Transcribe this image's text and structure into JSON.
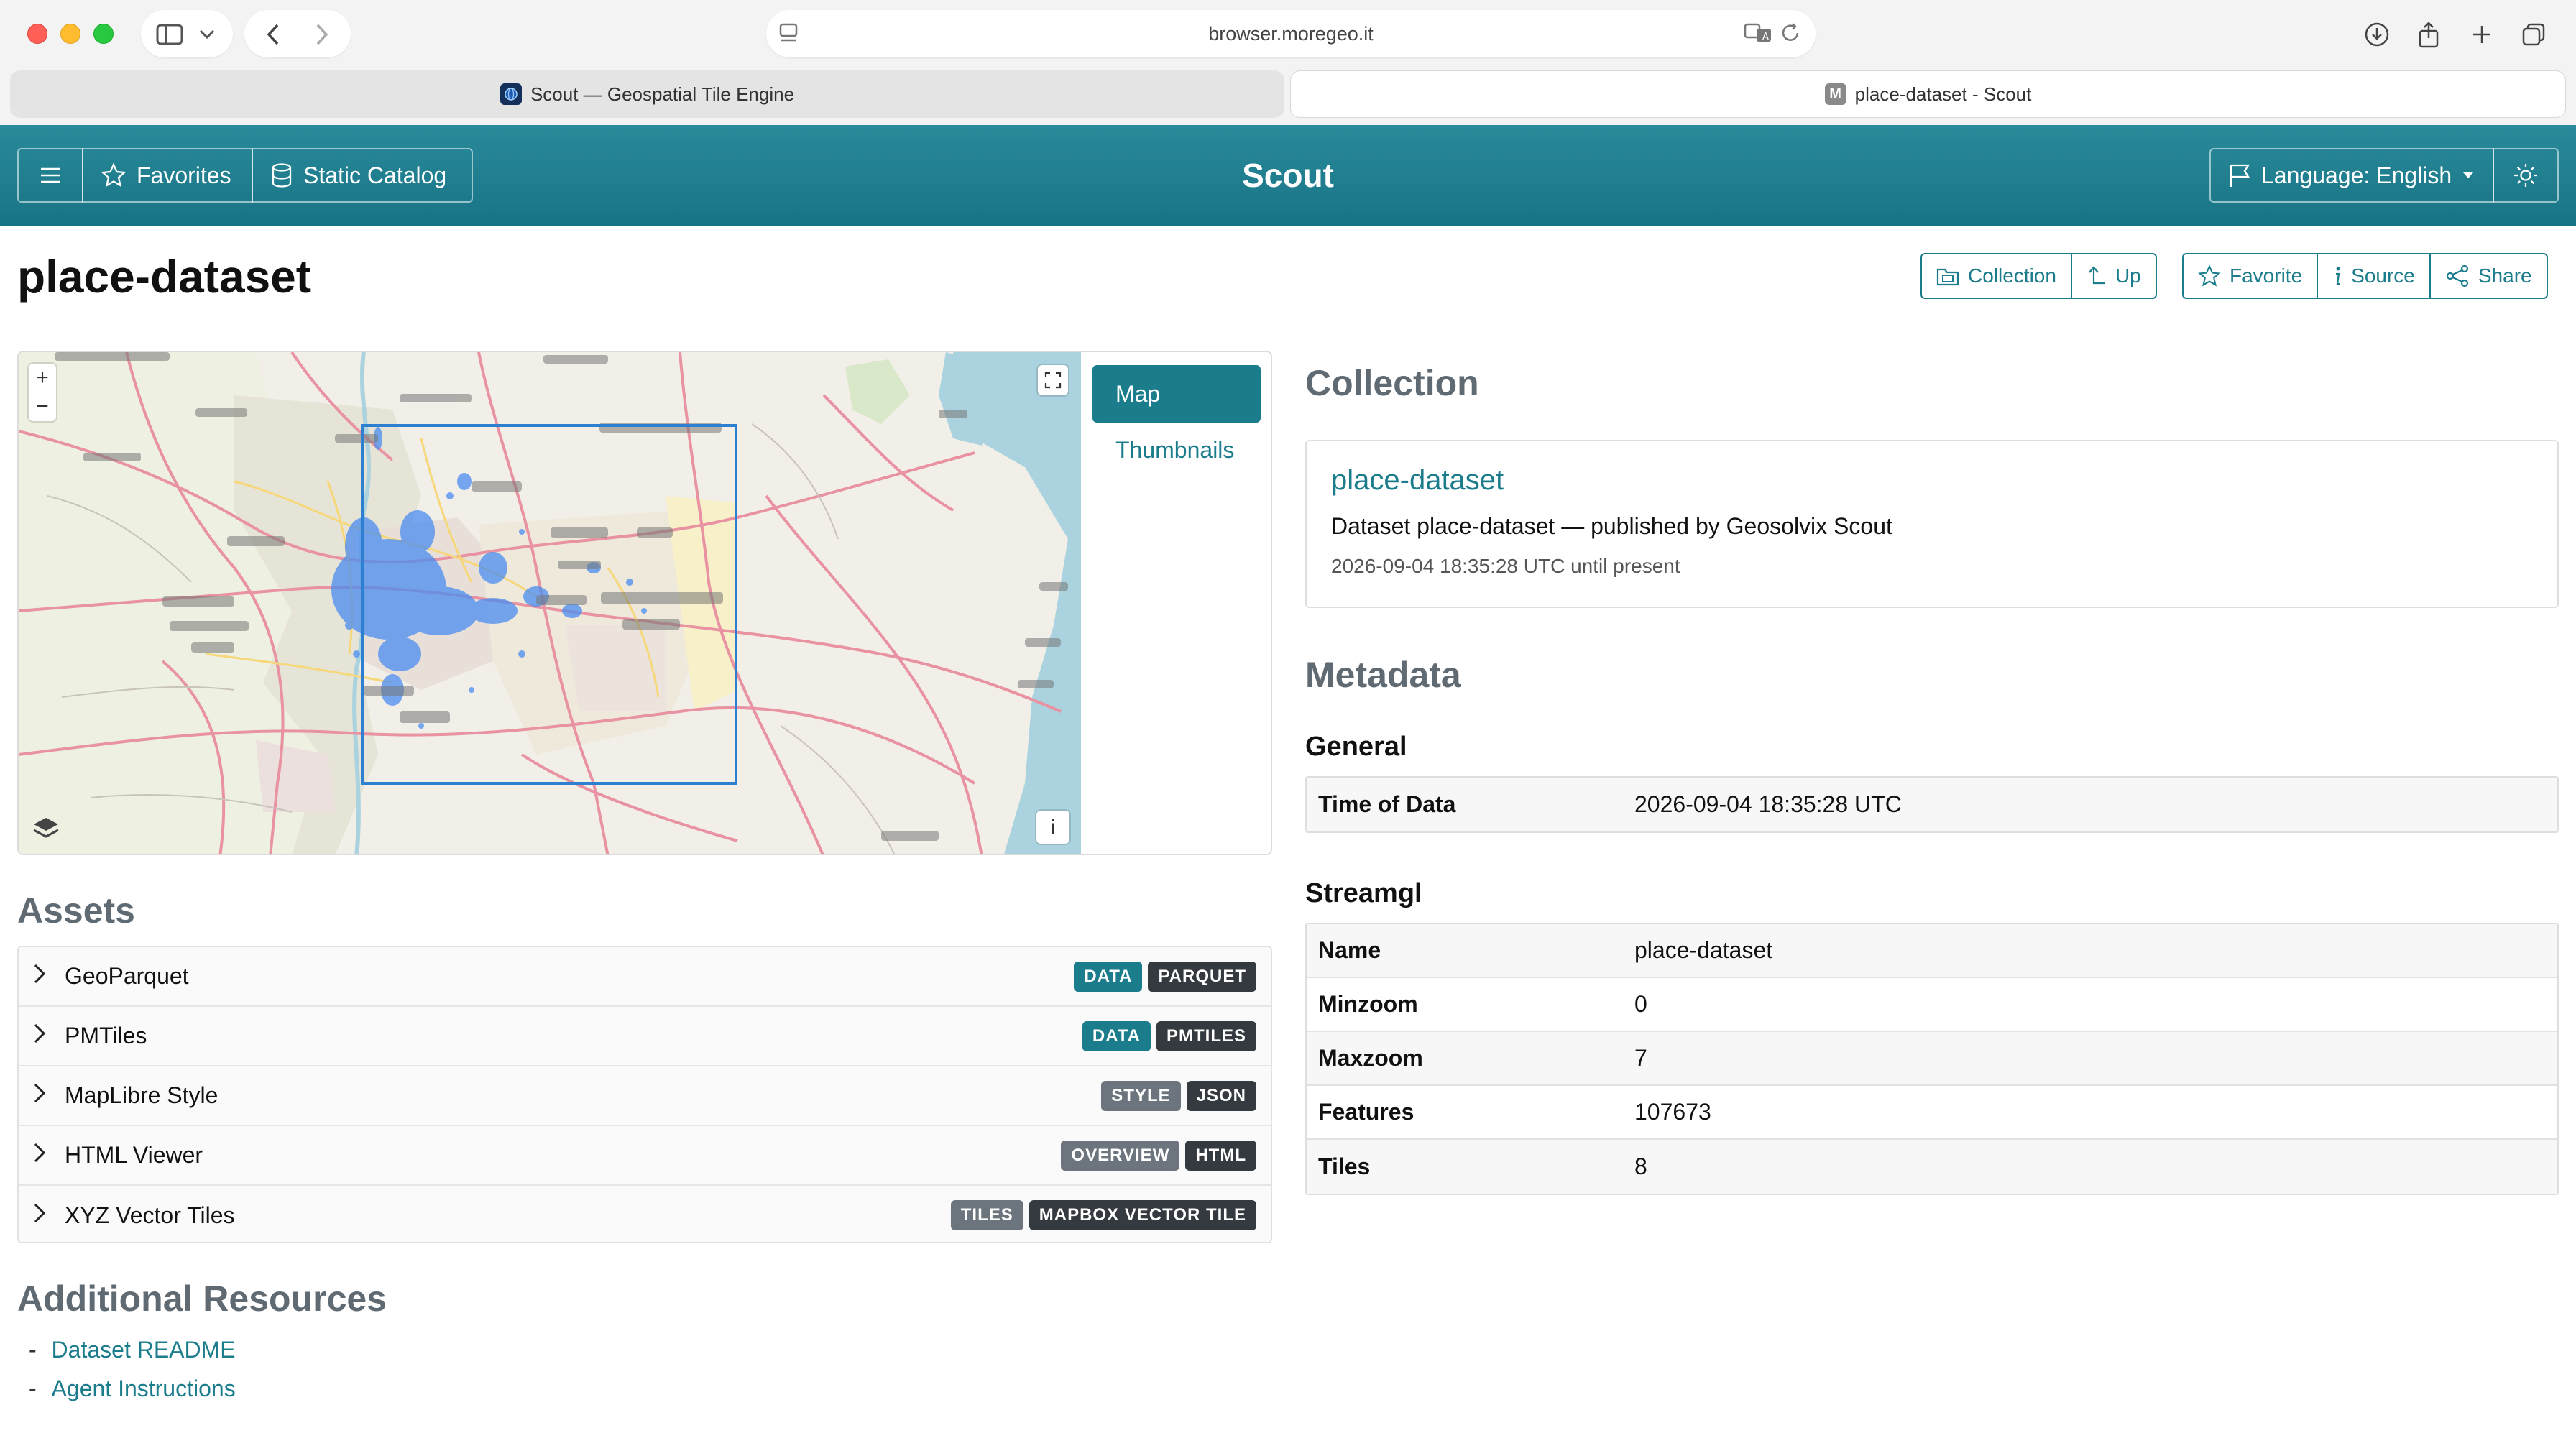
{
  "browser": {
    "url": "browser.moregeo.it",
    "tabs": [
      {
        "title": "Scout — Geospatial Tile Engine"
      },
      {
        "title": "place-dataset - Scout",
        "favicon_letter": "M"
      }
    ]
  },
  "header": {
    "title": "Scout",
    "favorites_label": "Favorites",
    "catalog_label": "Static Catalog",
    "language_label": "Language: English"
  },
  "page": {
    "title": "place-dataset",
    "actions": {
      "collection": "Collection",
      "up": "Up",
      "favorite": "Favorite",
      "source": "Source",
      "share": "Share"
    }
  },
  "map": {
    "zoom_in": "+",
    "zoom_out": "−",
    "info": "i",
    "tabs": {
      "map": "Map",
      "thumbnails": "Thumbnails"
    },
    "overlay_label": "place-dataset"
  },
  "assets": {
    "heading": "Assets",
    "items": [
      {
        "name": "GeoParquet",
        "badges": [
          {
            "text": "DATA",
            "kind": "primary"
          },
          {
            "text": "PARQUET",
            "kind": "dark"
          }
        ]
      },
      {
        "name": "PMTiles",
        "badges": [
          {
            "text": "DATA",
            "kind": "primary"
          },
          {
            "text": "PMTILES",
            "kind": "dark"
          }
        ]
      },
      {
        "name": "MapLibre Style",
        "badges": [
          {
            "text": "STYLE",
            "kind": "secondary"
          },
          {
            "text": "JSON",
            "kind": "dark"
          }
        ]
      },
      {
        "name": "HTML Viewer",
        "badges": [
          {
            "text": "OVERVIEW",
            "kind": "secondary"
          },
          {
            "text": "HTML",
            "kind": "dark"
          }
        ]
      },
      {
        "name": "XYZ Vector Tiles",
        "badges": [
          {
            "text": "TILES",
            "kind": "secondary"
          },
          {
            "text": "MAPBOX VECTOR TILE",
            "kind": "dark"
          }
        ]
      }
    ]
  },
  "resources": {
    "heading": "Additional Resources",
    "items": [
      "Dataset README",
      "Agent Instructions"
    ]
  },
  "collection": {
    "heading": "Collection",
    "title": "place-dataset",
    "description": "Dataset place-dataset — published by Geosolvix Scout",
    "time": "2026-09-04 18:35:28 UTC until present"
  },
  "metadata": {
    "heading": "Metadata",
    "general": {
      "heading": "General",
      "rows": [
        {
          "key": "Time of Data",
          "value": "2026-09-04 18:35:28 UTC"
        }
      ]
    },
    "streamgl": {
      "heading": "Streamgl",
      "rows": [
        {
          "key": "Name",
          "value": "place-dataset"
        },
        {
          "key": "Minzoom",
          "value": "0"
        },
        {
          "key": "Maxzoom",
          "value": "7"
        },
        {
          "key": "Features",
          "value": "107673"
        },
        {
          "key": "Tiles",
          "value": "8"
        }
      ]
    }
  },
  "colors": {
    "accent": "#1b7c8c",
    "badge_primary": "#1b7c8c",
    "badge_secondary": "#6c757d",
    "badge_dark": "#343a40"
  }
}
